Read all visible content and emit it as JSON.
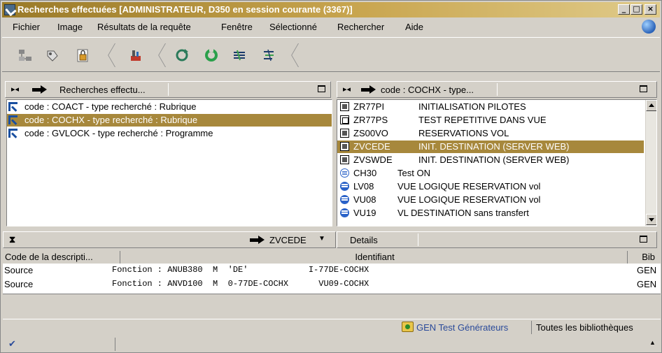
{
  "window": {
    "title": "Recherches effectuées [ADMINISTRATEUR, D350 en session courante (3367)]",
    "controls": [
      "_",
      "□",
      "×"
    ]
  },
  "menu": [
    "Fichier",
    "Image",
    "Résultats de la requête",
    "Fenêtre",
    "Sélectionné",
    "Rechercher",
    "Aide"
  ],
  "toolbar": {
    "icons": [
      "network-icon",
      "tag-icon",
      "lock-page-icon",
      "tools-icon",
      "refresh-tool-icon",
      "green-cycle-icon",
      "filter-icon",
      "tree-icon"
    ]
  },
  "left_panel": {
    "header": "Recherches effectu...",
    "items": [
      {
        "label": "code : COACT - type recherché : Rubrique",
        "selected": false
      },
      {
        "label": "code : COCHX - type recherché : Rubrique",
        "selected": true
      },
      {
        "label": "code : GVLOCK - type recherché : Programme",
        "selected": false
      }
    ]
  },
  "right_panel": {
    "header": "code : COCHX - type...",
    "items": [
      {
        "code": "ZR77PI",
        "desc": "INITIALISATION PILOTES",
        "icon": "screen-icon",
        "selected": false
      },
      {
        "code": "ZR77PS",
        "desc": "TEST REPETITIVE DANS VUE",
        "icon": "empty-screen-icon",
        "selected": false
      },
      {
        "code": "ZS00VO",
        "desc": "RESERVATIONS VOL",
        "icon": "screen-icon",
        "selected": false
      },
      {
        "code": "ZVCEDE",
        "desc": "INIT. DESTINATION (SERVER WEB)",
        "icon": "screen-icon",
        "selected": true
      },
      {
        "code": "ZVSWDE",
        "desc": "INIT. DESTINATION (SERVER WEB)",
        "icon": "screen-icon",
        "selected": false
      },
      {
        "code": "CH30",
        "desc": "Test ON",
        "icon": "lines-icon",
        "selected": false
      },
      {
        "code": "LV08",
        "desc": "VUE LOGIQUE RESERVATION vol",
        "icon": "database-icon",
        "selected": false
      },
      {
        "code": "VU08",
        "desc": "VUE LOGIQUE RESERVATION vol",
        "icon": "database-icon",
        "selected": false
      },
      {
        "code": "VU19",
        "desc": "VL DESTINATION sans transfert",
        "icon": "database-icon",
        "selected": false
      }
    ]
  },
  "details": {
    "selector": "ZVCEDE",
    "tab": "Details",
    "columns": [
      "Code de la descripti...",
      "Identifiant",
      "Bib"
    ],
    "rows": [
      {
        "code": "Source",
        "ident": "Fonction : ANUB380  M  'DE'            I-77DE-COCHX",
        "bib": "GEN"
      },
      {
        "code": "Source",
        "ident": "Fonction : ANVD100  M  0-77DE-COCHX      VU09-COCHX",
        "bib": "GEN"
      }
    ]
  },
  "status": {
    "library": "GEN Test Générateurs",
    "all_libraries": "Toutes les bibliothèques",
    "check": "✔",
    "up": "▲"
  }
}
